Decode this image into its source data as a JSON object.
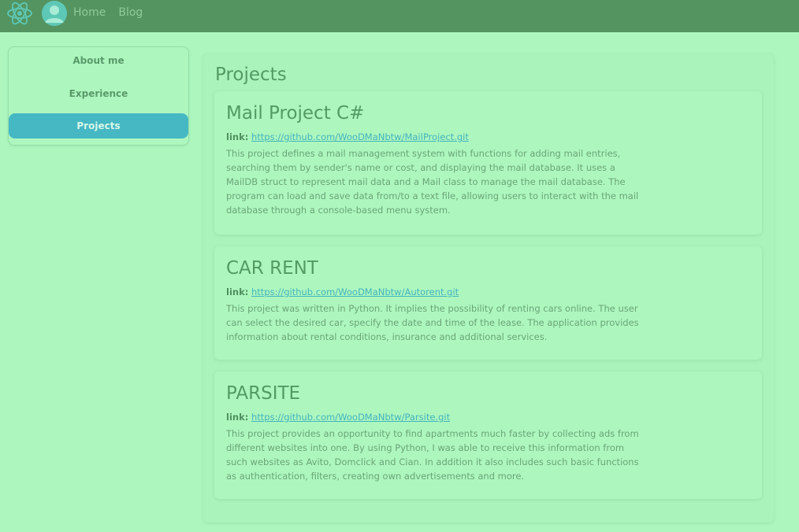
{
  "nav": {
    "home": "Home",
    "blog": "Blog"
  },
  "sidebar": {
    "items": [
      {
        "label": "About me",
        "active": false
      },
      {
        "label": "Experience",
        "active": false
      },
      {
        "label": "Projects",
        "active": true
      }
    ]
  },
  "main": {
    "title": "Projects",
    "projects": [
      {
        "title": "Mail Project C#",
        "link_label": "link:",
        "link": "https://github.com/WooDMaNbtw/MailProject.git",
        "description": "This project defines a mail management system with functions for adding mail entries, searching them by sender's name or cost, and displaying the mail database. It uses a MailDB struct to represent mail data and a Mail class to manage the mail database. The program can load and save data from/to a text file, allowing users to interact with the mail database through a console-based menu system."
      },
      {
        "title": "CAR RENT",
        "link_label": "link:",
        "link": "https://github.com/WooDMaNbtw/Autorent.git",
        "description": "This project was written in Python. It implies the possibility of renting cars online. The user can select the desired car, specify the date and time of the lease. The application provides information about rental conditions, insurance and additional services."
      },
      {
        "title": "PARSITE",
        "link_label": "link:",
        "link": "https://github.com/WooDMaNbtw/Parsite.git",
        "description": "This project provides an opportunity to find apartments much faster by collecting ads from different websites into one. By using Python, I was able to receive this information from such websites as Avito, Domclick and Cian. In addition it also includes such basic functions as authentication, filters, creating own advertisements and more."
      }
    ]
  },
  "colors": {
    "background": "#adf7bf",
    "navbar": "#539460",
    "accent": "#46b8c4",
    "link": "#44b3bb"
  },
  "icons": {
    "logo": "react-atom-icon",
    "avatar": "user-avatar-icon"
  }
}
